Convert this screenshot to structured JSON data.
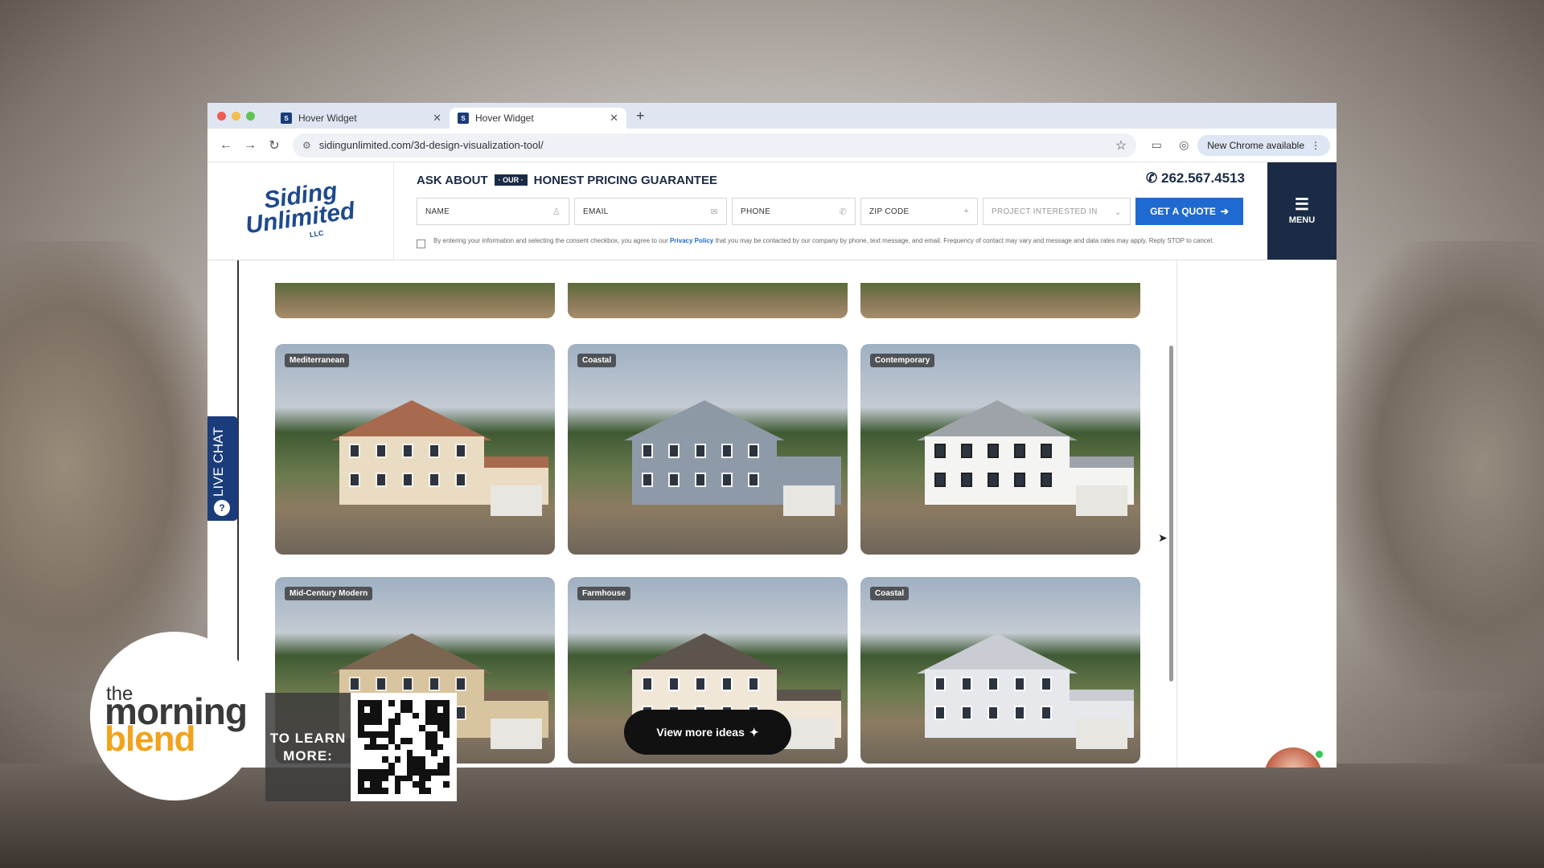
{
  "browser": {
    "tabs": [
      {
        "label": "Hover Widget",
        "active": false
      },
      {
        "label": "Hover Widget",
        "active": true
      }
    ],
    "url": "sidingunlimited.com/3d-design-visualization-tool/",
    "new_chrome_label": "New Chrome available"
  },
  "site": {
    "logo": {
      "line1": "Siding",
      "line2": "Unlimited",
      "line3": "LLC"
    },
    "guarantee": {
      "prefix": "ASK ABOUT",
      "badge": "· OUR ·",
      "suffix": "HONEST PRICING GUARANTEE"
    },
    "phone": "262.567.4513",
    "fields": {
      "name": "NAME",
      "email": "EMAIL",
      "phone": "PHONE",
      "zip": "ZIP CODE",
      "project": "PROJECT INTERESTED IN"
    },
    "quote_button": "GET A QUOTE",
    "consent_text_1": "By entering your information and selecting the consent checkbox, you agree to our",
    "consent_link": "Privacy Policy",
    "consent_text_2": "that you may be contacted by our company by phone, text message, and email. Frequency of contact may vary and message and data rates may apply. Reply STOP to cancel.",
    "menu_label": "MENU"
  },
  "gallery": {
    "cards": [
      {
        "tag": "Mediterranean",
        "roof": "#a86a4e",
        "wall": "#e9dcc3",
        "trim": "#f7f2ea"
      },
      {
        "tag": "Coastal",
        "roof": "#8e99a6",
        "wall": "#8f9aa9",
        "trim": "#f3f5f7"
      },
      {
        "tag": "Contemporary",
        "roof": "#9ea3a9",
        "wall": "#f4f4f2",
        "trim": "#222222"
      },
      {
        "tag": "Mid-Century Modern",
        "roof": "#7b6652",
        "wall": "#d8c49f",
        "trim": "#efe8da"
      },
      {
        "tag": "Farmhouse",
        "roof": "#5d544c",
        "wall": "#f0e7d8",
        "trim": "#ffffff"
      },
      {
        "tag": "Coastal",
        "roof": "#c9ccd2",
        "wall": "#e7e8ec",
        "trim": "#ffffff"
      }
    ],
    "view_more": "View more ideas"
  },
  "live_chat": "LIVE CHAT",
  "overlay": {
    "brand_the": "the",
    "brand_morning": "morning",
    "brand_blend": "blend",
    "learn_more": "TO LEARN MORE:"
  }
}
